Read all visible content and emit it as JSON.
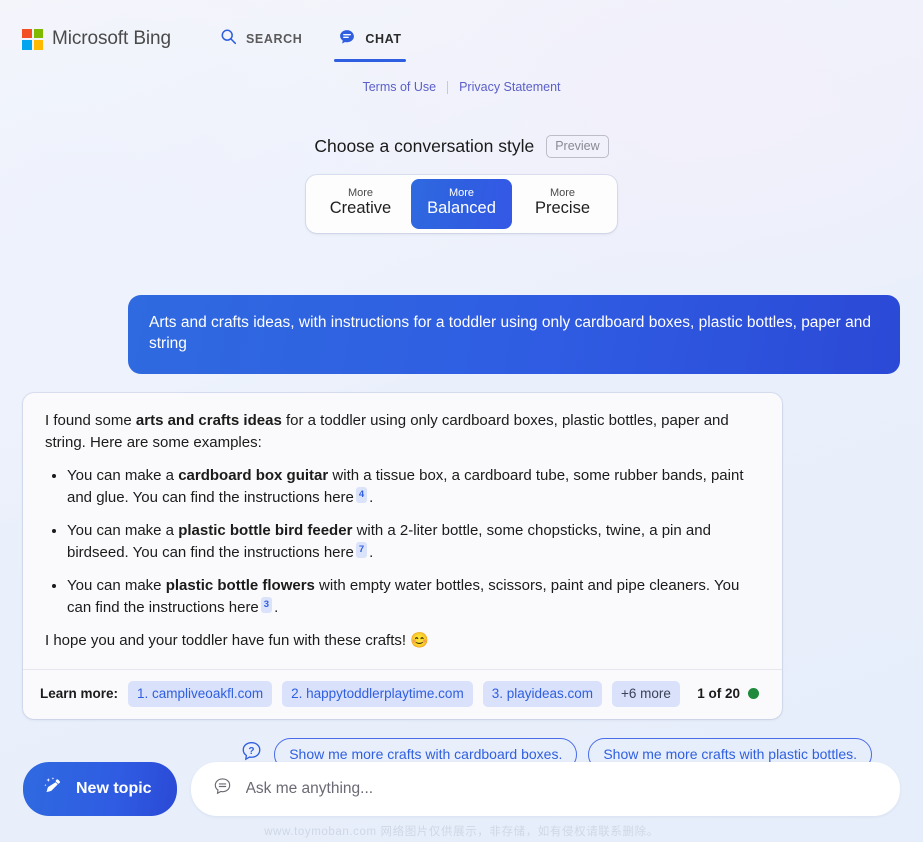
{
  "header": {
    "brand_name": "Microsoft Bing",
    "logo_colors": [
      "#f25022",
      "#7fba00",
      "#00a4ef",
      "#ffb900"
    ],
    "nav": [
      {
        "label": "SEARCH",
        "icon": "search-icon",
        "active": false
      },
      {
        "label": "CHAT",
        "icon": "chat-bubble-icon",
        "active": true
      }
    ],
    "accent_color": "#2f5fe0"
  },
  "legal": {
    "terms_label": "Terms of Use",
    "privacy_label": "Privacy Statement"
  },
  "style_selector": {
    "title": "Choose a conversation style",
    "preview_badge": "Preview",
    "options": [
      {
        "line1": "More",
        "line2": "Creative",
        "selected": false
      },
      {
        "line1": "More",
        "line2": "Balanced",
        "selected": true
      },
      {
        "line1": "More",
        "line2": "Precise",
        "selected": false
      }
    ]
  },
  "conversation": {
    "user_message": "Arts and crafts ideas, with instructions for a toddler using only cardboard boxes, plastic bottles, paper and string",
    "answer": {
      "intro_pre": "I found some ",
      "intro_bold": "arts and crafts ideas",
      "intro_post": " for a toddler using only cardboard boxes, plastic bottles, paper and string. Here are some examples:",
      "bullets": [
        {
          "pre": "You can make a ",
          "bold": "cardboard box guitar",
          "post": " with a tissue box, a cardboard tube, some rubber bands, paint and glue. You can find the instructions here",
          "citation": "4",
          "tail": "."
        },
        {
          "pre": "You can make a ",
          "bold": "plastic bottle bird feeder",
          "post": " with a 2-liter bottle, some chopsticks, twine, a pin and birdseed. You can find the instructions here",
          "citation": "7",
          "tail": "."
        },
        {
          "pre": "You can make ",
          "bold": "plastic bottle flowers",
          "post": " with empty water bottles, scissors, paint and pipe cleaners. You can find the instructions here",
          "citation": "3",
          "tail": "."
        }
      ],
      "closing": "I hope you and your toddler have fun with these crafts!",
      "closing_emoji": "😊"
    },
    "learn_more": {
      "label": "Learn more:",
      "sources": [
        "1. campliveoakfl.com",
        "2. happytoddlerplaytime.com",
        "3. playideas.com"
      ],
      "more_label": "+6 more",
      "pager_text": "1 of 20",
      "pager_dot_color": "#1f8a3b"
    }
  },
  "suggestions": {
    "icon": "question-bubble-icon",
    "chips": [
      "Show me more crafts with cardboard boxes.",
      "Show me more crafts with plastic bottles."
    ]
  },
  "composer": {
    "new_topic_label": "New topic",
    "new_topic_icon": "broom-sparkle-icon",
    "input_icon": "chat-lines-icon",
    "input_placeholder": "Ask me anything...",
    "input_value": ""
  },
  "watermark": {
    "text": "www.toymoban.com 网络图片仅供展示，非存储，如有侵权请联系删除。"
  }
}
